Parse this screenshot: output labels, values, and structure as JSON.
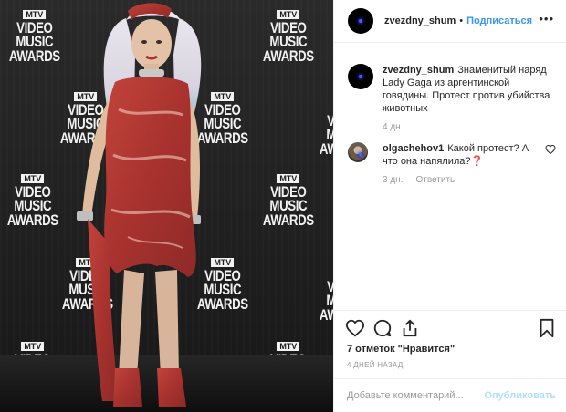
{
  "photo": {
    "backdrop_logo": {
      "badge": "MTV",
      "lines": [
        "VIDEO",
        "MUSIC",
        "AWARDS"
      ]
    }
  },
  "header": {
    "username": "zvezdny_shum",
    "separator": "•",
    "follow_label": "Подписаться",
    "more_icon": "more-horizontal-icon"
  },
  "caption": {
    "username": "zvezdny_shum",
    "text": "Знаменитый наряд Lady Gaga из аргентинской говядины. Протест против убийства животных",
    "time": "4 дн."
  },
  "comments": [
    {
      "username": "olgachehov1",
      "text": "Какой протест? А что она напялила?❓",
      "time": "3 дн.",
      "reply_label": "Ответить"
    }
  ],
  "actions": {
    "icons": [
      "heart-icon",
      "comment-icon",
      "share-icon",
      "bookmark-icon"
    ],
    "likes": "7 отметок \"Нравится\"",
    "time_ago": "4 ДНЕЙ НАЗАД"
  },
  "add_comment": {
    "placeholder": "Добавьте комментарий...",
    "post_label": "Опубликовать"
  },
  "colors": {
    "accent": "#3897f0",
    "post_disabled": "#b2dffc",
    "muted": "#999999",
    "text": "#262626"
  }
}
